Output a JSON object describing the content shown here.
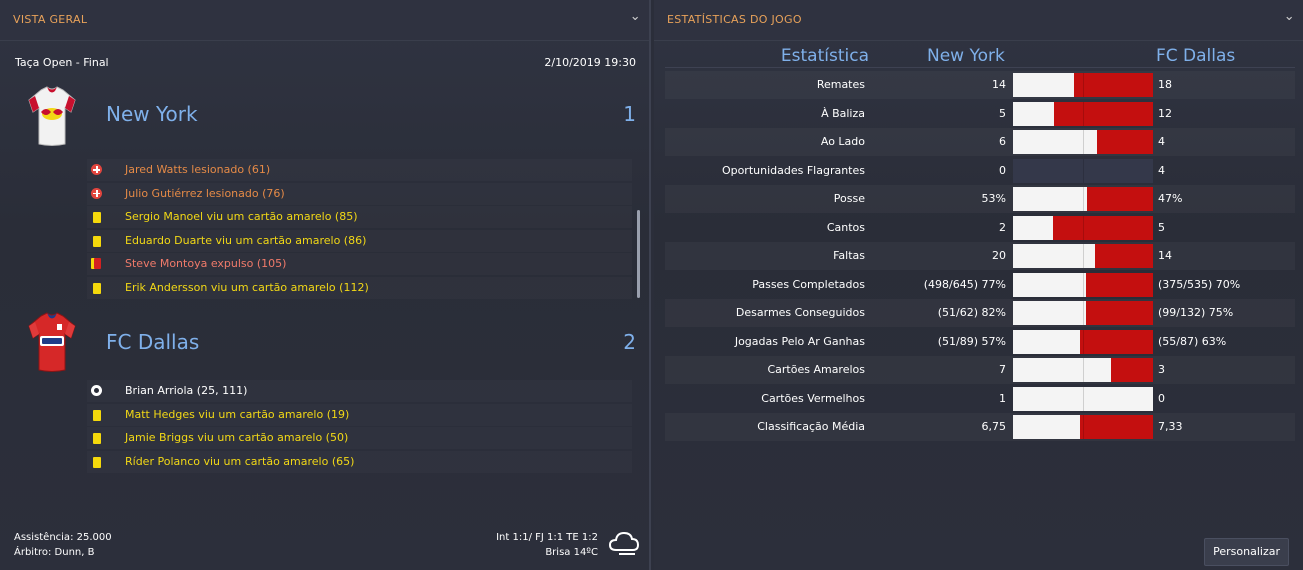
{
  "left_panel": {
    "title": "VISTA GERAL",
    "competition": "Taça Open - Final",
    "datetime": "2/10/2019 19:30",
    "home": {
      "name": "New York",
      "score": "1",
      "kit_colors": {
        "body": "#f2f2f2",
        "accent": "#c8102e",
        "sleeve": "#d9d9d9"
      },
      "events": [
        {
          "icon": "injury-icon",
          "text": "Jared Watts lesionado (61)",
          "color": "#e58a47"
        },
        {
          "icon": "injury-icon",
          "text": "Julio Gutiérrez lesionado (76)",
          "color": "#e58a47"
        },
        {
          "icon": "yellow-card-icon",
          "text": "Sergio Manoel viu um cartão amarelo (85)",
          "color": "#f2d816"
        },
        {
          "icon": "yellow-card-icon",
          "text": "Eduardo Duarte viu um cartão amarelo (86)",
          "color": "#f2d816"
        },
        {
          "icon": "red-card-icon",
          "text": "Steve Montoya expulso (105)",
          "color": "#f07a6a"
        },
        {
          "icon": "yellow-card-icon",
          "text": "Erik Andersson viu um cartão amarelo (112)",
          "color": "#f2d816"
        }
      ]
    },
    "away": {
      "name": "FC Dallas",
      "score": "2",
      "kit_colors": {
        "body": "#d62828",
        "accent": "#1f3c88",
        "sleeve": "#e03a3a"
      },
      "events": [
        {
          "icon": "goal-ball-icon",
          "text": "Brian Arriola (25, 111)",
          "color": "#ffffff"
        },
        {
          "icon": "yellow-card-icon",
          "text": "Matt Hedges viu um cartão amarelo (19)",
          "color": "#f2d816"
        },
        {
          "icon": "yellow-card-icon",
          "text": "Jamie Briggs viu um cartão amarelo (50)",
          "color": "#f2d816"
        },
        {
          "icon": "yellow-card-icon",
          "text": "Ríder Polanco viu um cartão amarelo (65)",
          "color": "#f2d816"
        }
      ]
    },
    "footer": {
      "attendance": "Assistência: 25.000",
      "referee": "Árbitro: Dunn, B",
      "ratings": "Int 1:1/ FJ 1:1 TE 1:2",
      "weather": "Brisa 14ºC",
      "weather_icon": "cloud-icon"
    }
  },
  "right_panel": {
    "title": "ESTATÍSTICAS DO JOGO",
    "col_stat": "Estatística",
    "col_home": "New York",
    "col_away": "FC Dallas",
    "button": "Personalizar",
    "home_color": "#f4f4f4",
    "away_color": "#c40f0f",
    "stats": [
      {
        "label": "Remates",
        "home": "14",
        "away": "18",
        "home_frac": 0.4375,
        "away_frac": 0.5625
      },
      {
        "label": "À Baliza",
        "home": "5",
        "away": "12",
        "home_frac": 0.294,
        "away_frac": 0.706
      },
      {
        "label": "Ao Lado",
        "home": "6",
        "away": "4",
        "home_frac": 0.6,
        "away_frac": 0.4
      },
      {
        "label": "Oportunidades Flagrantes",
        "home": "0",
        "away": "4",
        "home_frac": 0,
        "away_frac": 0
      },
      {
        "label": "Posse",
        "home": "53%",
        "away": "47%",
        "home_frac": 0.53,
        "away_frac": 0.47
      },
      {
        "label": "Cantos",
        "home": "2",
        "away": "5",
        "home_frac": 0.286,
        "away_frac": 0.714
      },
      {
        "label": "Faltas",
        "home": "20",
        "away": "14",
        "home_frac": 0.588,
        "away_frac": 0.412
      },
      {
        "label": "Passes Completados",
        "home": "(498/645) 77%",
        "away": "(375/535) 70%",
        "home_frac": 0.524,
        "away_frac": 0.476
      },
      {
        "label": "Desarmes Conseguidos",
        "home": "(51/62) 82%",
        "away": "(99/132) 75%",
        "home_frac": 0.522,
        "away_frac": 0.478
      },
      {
        "label": "Jogadas Pelo Ar Ganhas",
        "home": "(51/89) 57%",
        "away": "(55/87) 63%",
        "home_frac": 0.475,
        "away_frac": 0.525
      },
      {
        "label": "Cartões Amarelos",
        "home": "7",
        "away": "3",
        "home_frac": 0.7,
        "away_frac": 0.3
      },
      {
        "label": "Cartões Vermelhos",
        "home": "1",
        "away": "0",
        "home_frac": 1.0,
        "away_frac": 0
      },
      {
        "label": "Classificação Média",
        "home": "6,75",
        "away": "7,33",
        "home_frac": 0.479,
        "away_frac": 0.521
      }
    ]
  }
}
